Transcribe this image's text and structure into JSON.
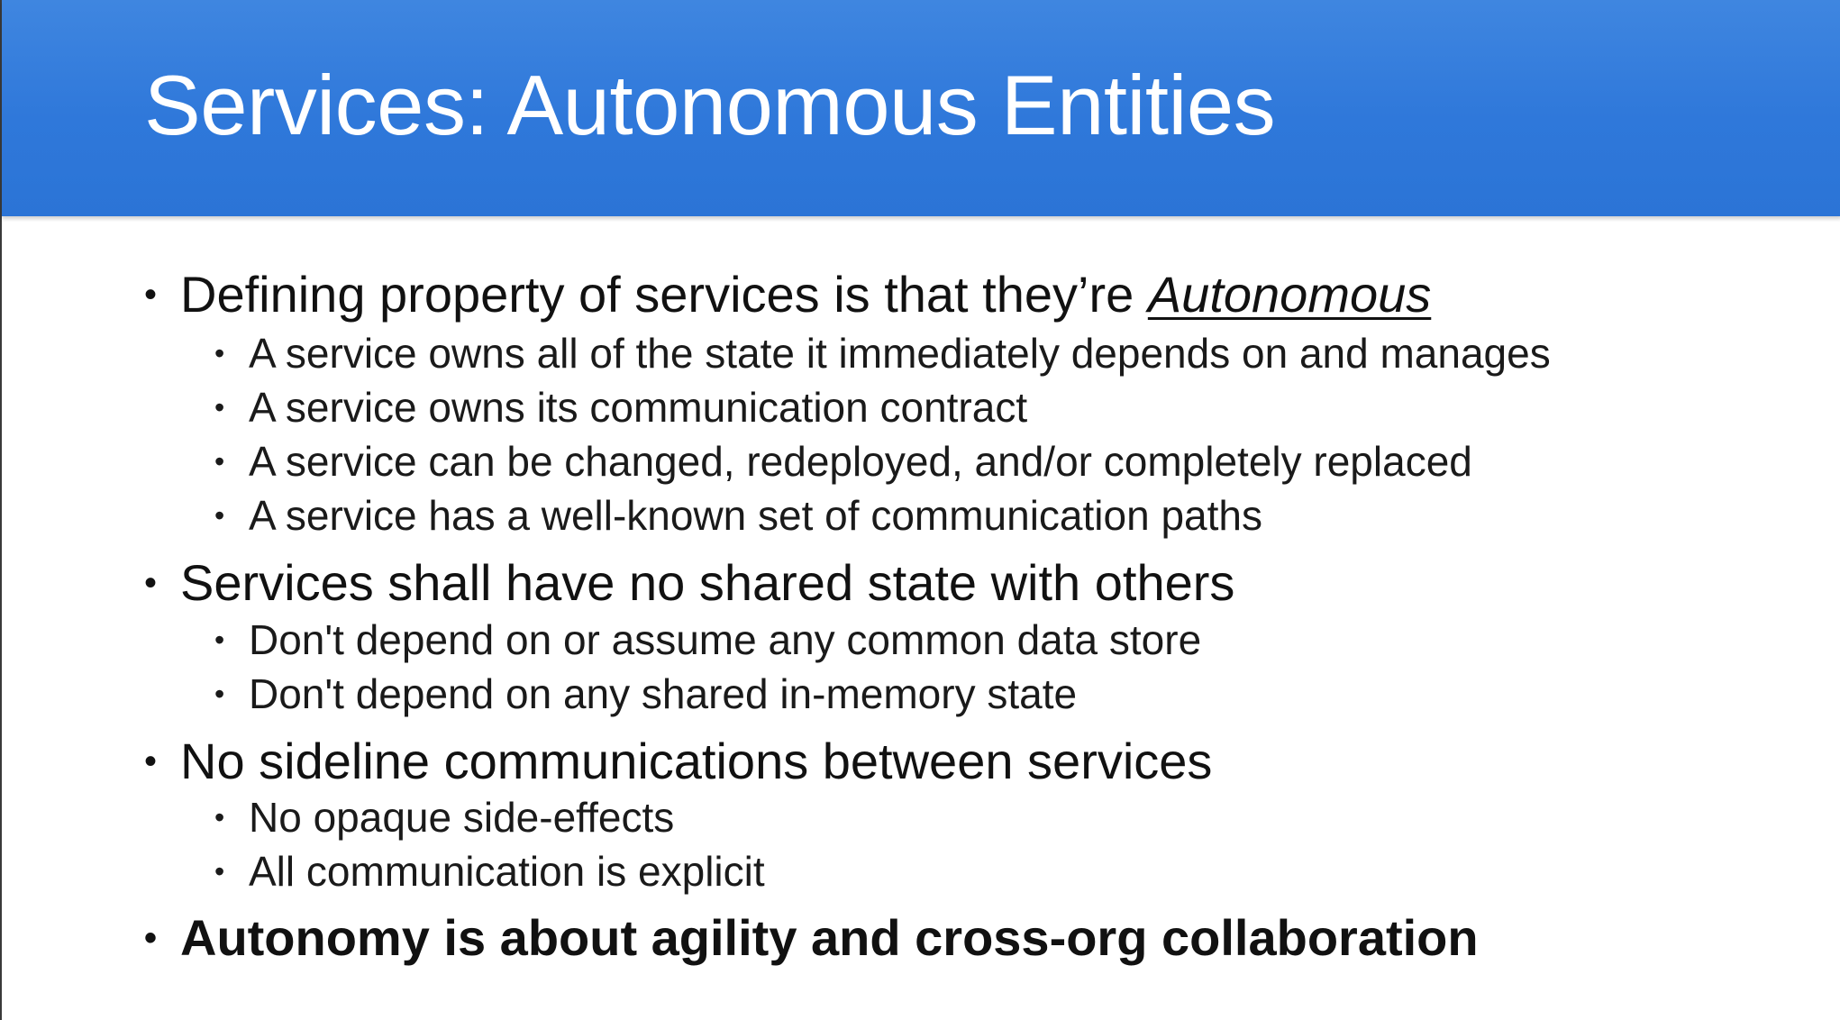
{
  "slide": {
    "title": "Services: Autonomous Entities",
    "bullet_char": "•",
    "bullets": [
      {
        "text_before": "Defining property of services is that they’re ",
        "emphasis": "Autonomous",
        "sub": [
          "A service owns all of the state it immediately depends on and manages",
          "A service owns its communication contract",
          "A service can be changed, redeployed, and/or completely replaced",
          "A service has a well-known set of communication paths"
        ]
      },
      {
        "text": "Services shall have no shared state with others",
        "sub": [
          "Don't depend on or assume any common data store",
          "Don't depend on any shared in-memory state"
        ]
      },
      {
        "text": "No sideline communications between services",
        "sub": [
          "No opaque side-effects",
          "All communication is explicit"
        ]
      },
      {
        "text": "Autonomy is about agility and cross-org collaboration"
      }
    ]
  },
  "colors": {
    "header_blue": "#2f78da",
    "title_text": "#ffffff",
    "body_text": "#111111",
    "background": "#ffffff"
  }
}
